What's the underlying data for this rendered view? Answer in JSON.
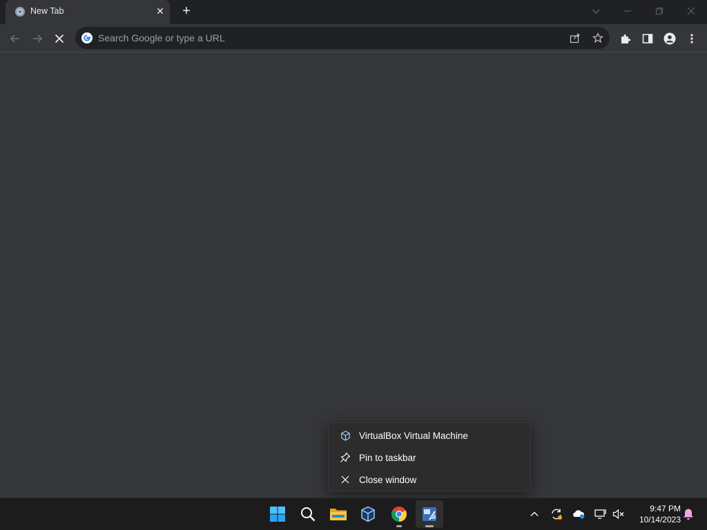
{
  "browser": {
    "tab": {
      "title": "New Tab"
    },
    "omnibox": {
      "placeholder": "Search Google or type a URL"
    }
  },
  "jumplist": {
    "items": [
      {
        "label": "VirtualBox Virtual Machine",
        "icon": "virtualbox-icon"
      },
      {
        "label": "Pin to taskbar",
        "icon": "pin-icon"
      },
      {
        "label": "Close window",
        "icon": "close-icon"
      }
    ]
  },
  "taskbar": {
    "apps": [
      "windows-start-icon",
      "search-icon",
      "file-explorer-icon",
      "virtualbox-icon",
      "chrome-icon",
      "active-app-icon"
    ],
    "tray": [
      "chevron-up-icon",
      "sync-icon",
      "onedrive-icon",
      "network-icon",
      "volume-muted-icon",
      "notification-bell-icon"
    ],
    "clock": {
      "time": "9:47 PM",
      "date": "10/14/2023"
    }
  },
  "colors": {
    "frame": "#202124",
    "toolbar": "#35363a",
    "taskbar": "#1c1c1c",
    "menu": "#2c2c2c",
    "text": "#e8eaed"
  }
}
